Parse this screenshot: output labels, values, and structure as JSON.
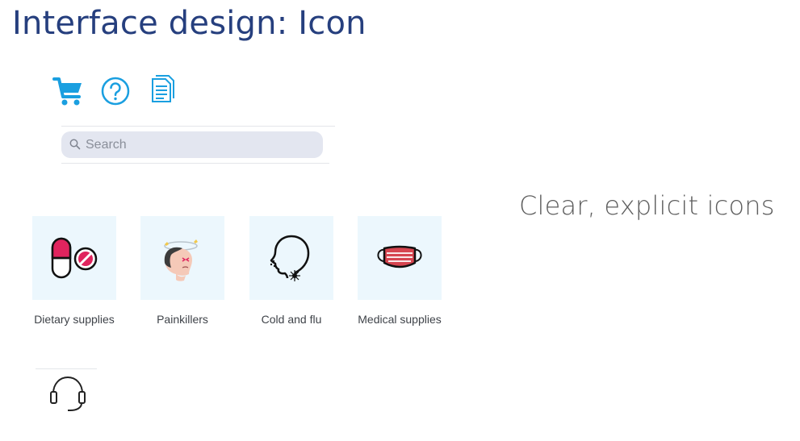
{
  "slide": {
    "title": "Interface design: Icon",
    "tagline": "Clear, explicit icons"
  },
  "toolbar": {
    "icons": [
      "cart-icon",
      "help-icon",
      "documents-icon"
    ],
    "accent_color": "#1a9fe0"
  },
  "search": {
    "placeholder": "Search"
  },
  "categories": [
    {
      "label": "Dietary supplies",
      "icon": "pills-icon"
    },
    {
      "label": "Painkillers",
      "icon": "headache-icon"
    },
    {
      "label": "Cold and flu",
      "icon": "cough-icon"
    },
    {
      "label": "Medical supplies",
      "icon": "face-mask-icon"
    }
  ],
  "support": {
    "icon": "headset-icon"
  },
  "colors": {
    "title": "#263f7e",
    "tile_background": "#ecf7fd",
    "search_background": "#e3e6f0",
    "pill_red": "#e0245e"
  }
}
